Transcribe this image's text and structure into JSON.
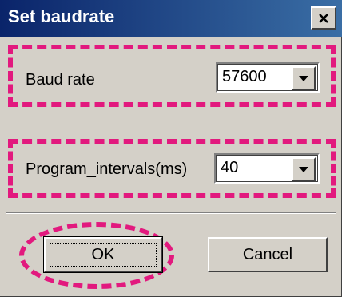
{
  "window": {
    "title": "Set baudrate",
    "close_icon": "close-icon"
  },
  "baud": {
    "label": "Baud rate",
    "value": "57600"
  },
  "interval": {
    "label": "Program_intervals(ms)",
    "value": "40"
  },
  "buttons": {
    "ok_label": "OK",
    "cancel_label": "Cancel"
  },
  "colors": {
    "highlight": "#e2197e",
    "titlebar": "#0a246a",
    "face": "#d4d0c8"
  }
}
